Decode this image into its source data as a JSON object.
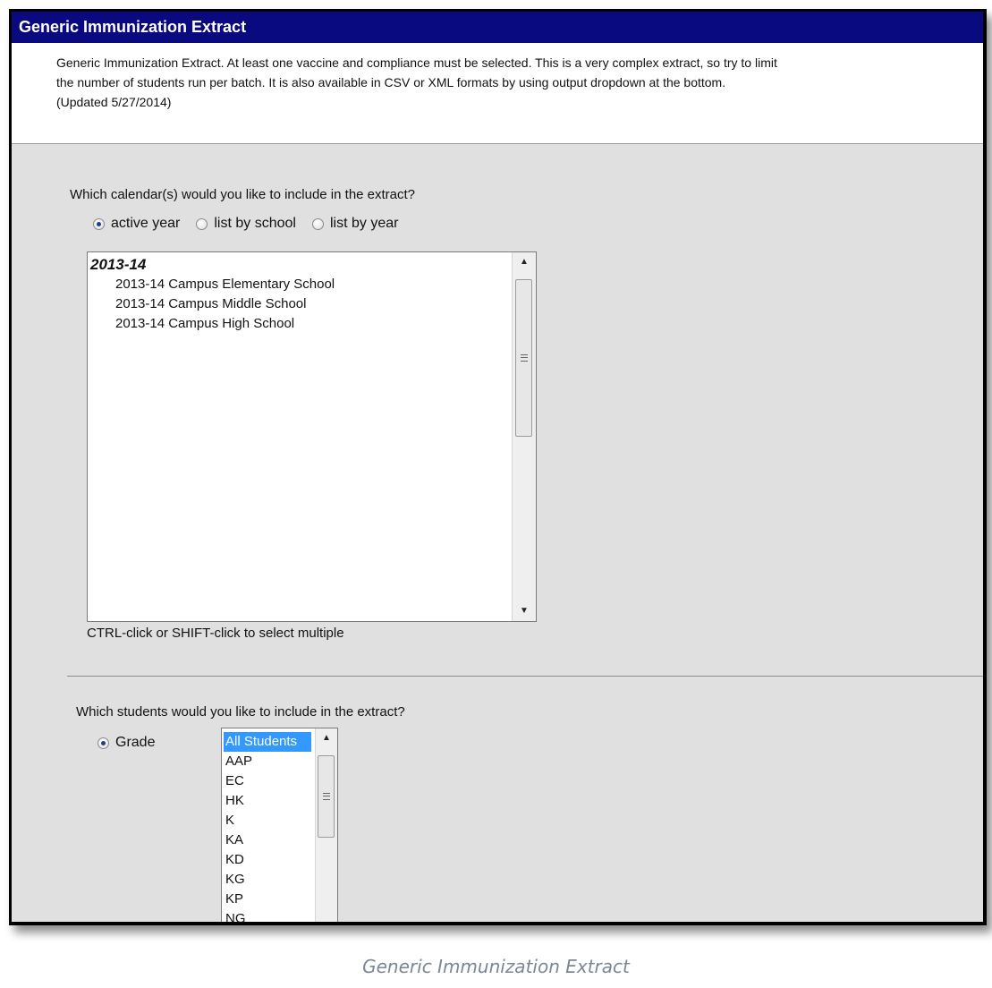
{
  "window": {
    "title": "Generic Immunization Extract"
  },
  "description": {
    "line1": "Generic Immunization Extract. At least one vaccine and compliance must be selected. This is a very complex extract, so try to limit",
    "line2": "the number of students run per batch. It is also available in CSV or XML formats by using output dropdown at the bottom.",
    "line3": "(Updated 5/27/2014)"
  },
  "calendar": {
    "question": "Which calendar(s) would you like to include in the extract?",
    "options": [
      {
        "label": "active year",
        "checked": true
      },
      {
        "label": "list by school",
        "checked": false
      },
      {
        "label": "list by year",
        "checked": false
      }
    ],
    "group_label": "2013-14",
    "items": [
      "2013-14 Campus Elementary School",
      "2013-14 Campus Middle School",
      "2013-14 Campus High School"
    ],
    "hint": "CTRL-click or SHIFT-click to select multiple"
  },
  "students": {
    "question": "Which students would you like to include in the extract?",
    "grade_option": {
      "label": "Grade",
      "checked": true
    },
    "grades": [
      "All Students",
      "AAP",
      "EC",
      "HK",
      "K",
      "KA",
      "KD",
      "KG",
      "KP",
      "NG"
    ],
    "selected_grade": "All Students"
  },
  "caption": "Generic Immunization Extract",
  "colors": {
    "titlebar": "#0a0a80",
    "panel": "#e0e0e0",
    "selection": "#3399ff"
  }
}
